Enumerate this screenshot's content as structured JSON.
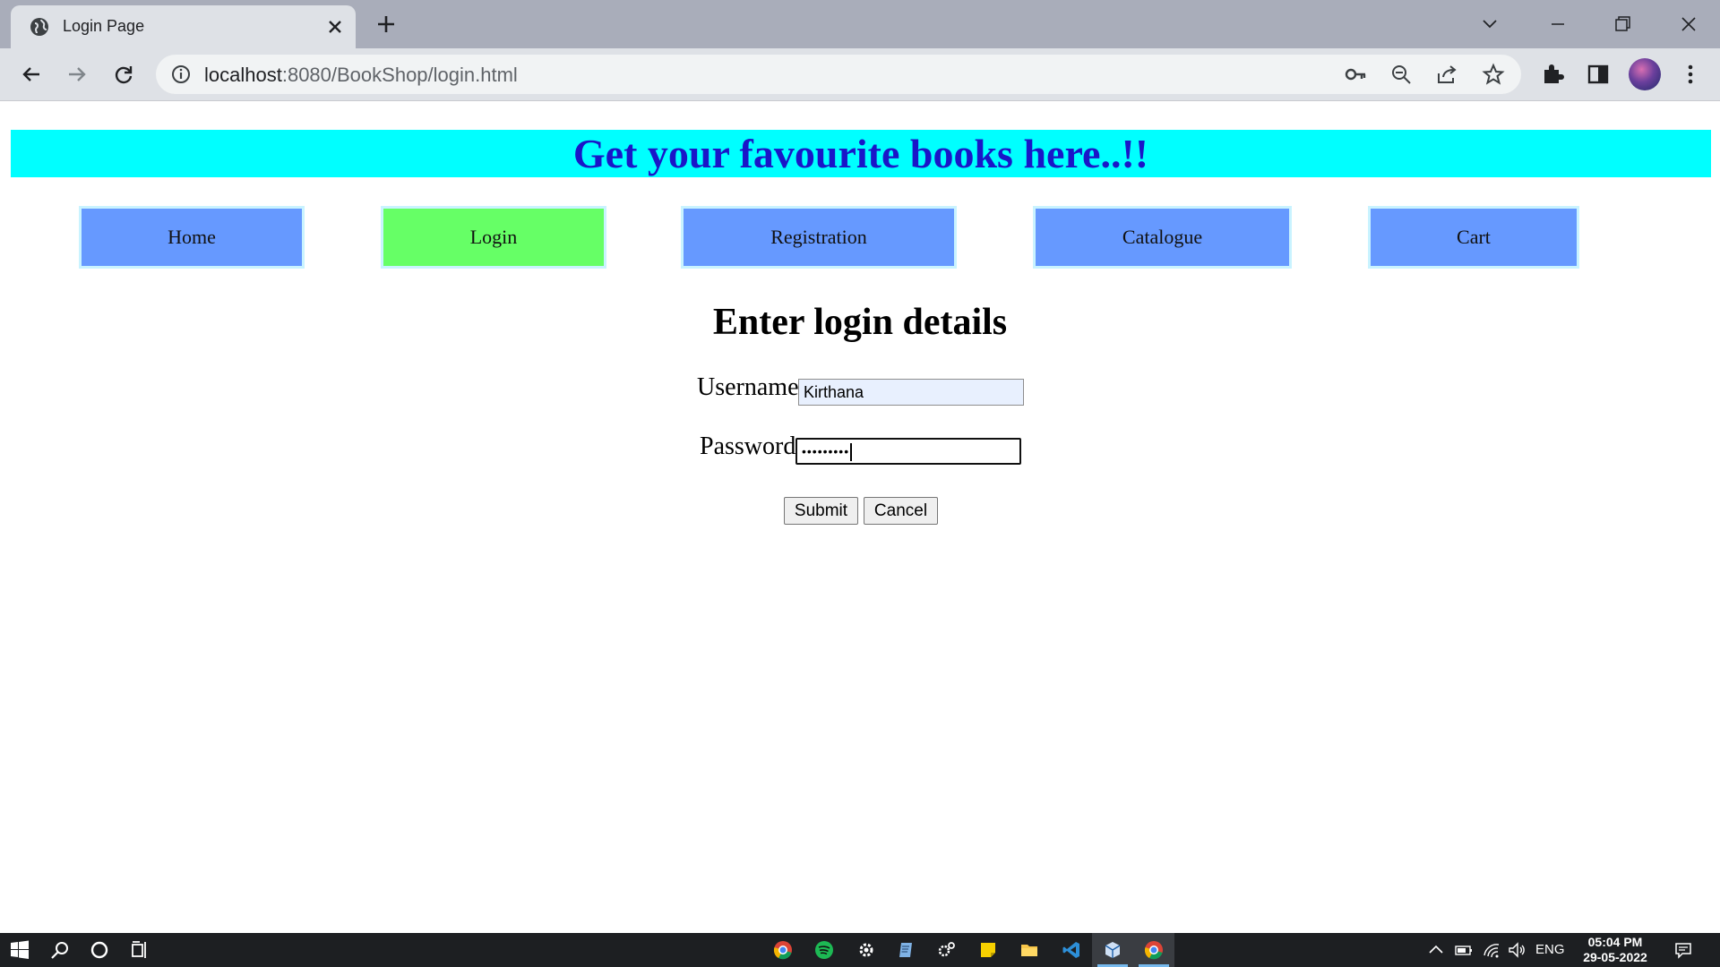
{
  "browser": {
    "tab_title": "Login Page",
    "url_host": "localhost",
    "url_rest": ":8080/BookShop/login.html",
    "icons": [
      "globe-icon",
      "close-icon",
      "plus-icon",
      "chevron-down-icon",
      "minimize-icon",
      "restore-icon",
      "window-close-icon",
      "back-icon",
      "forward-icon",
      "reload-icon",
      "info-icon",
      "key-icon",
      "zoom-out-icon",
      "share-icon",
      "star-icon",
      "extensions-icon",
      "side-panel-icon",
      "avatar",
      "menu-icon"
    ]
  },
  "page": {
    "banner": "Get your favourite books here..!!",
    "nav": {
      "home": "Home",
      "login": "Login",
      "registration": "Registration",
      "catalogue": "Catalogue",
      "cart": "Cart"
    },
    "heading": "Enter login details",
    "form": {
      "username_label": "Username",
      "username_value": "Kirthana",
      "password_label": "Password",
      "password_mask": "•••••••••",
      "submit": "Submit",
      "cancel": "Cancel"
    },
    "colors": {
      "banner_bg": "#00ffff",
      "banner_text": "#1a16c8",
      "nav_blue": "#6699ff",
      "nav_active": "#66ff66"
    }
  },
  "taskbar": {
    "language": "ENG",
    "time": "05:04 PM",
    "date": "29-05-2022"
  }
}
